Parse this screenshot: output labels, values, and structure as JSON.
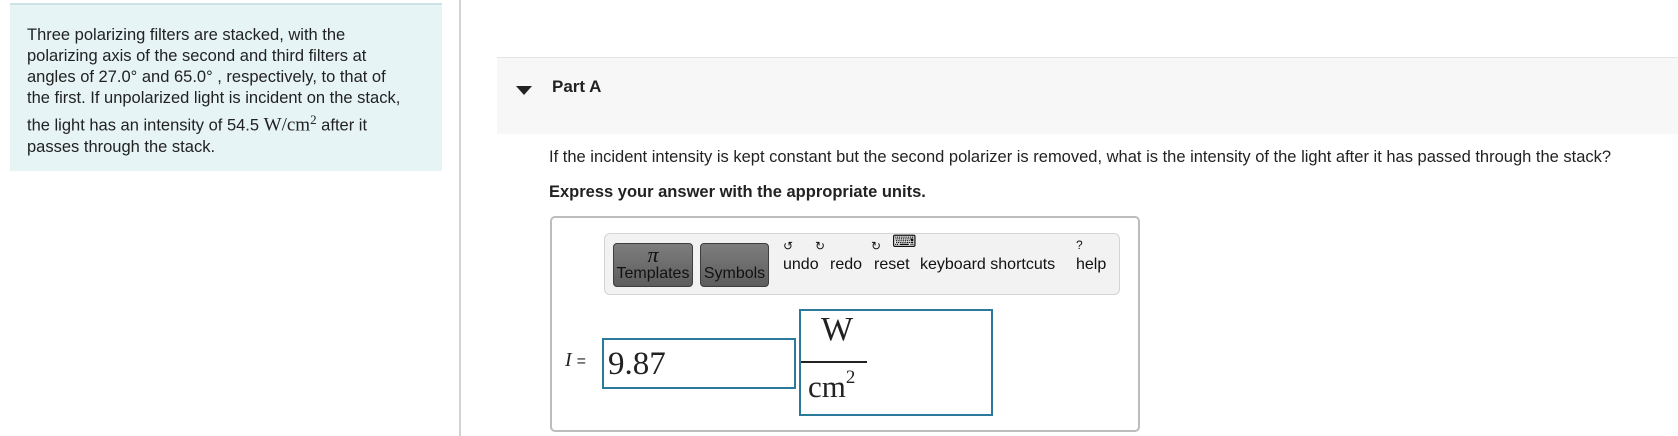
{
  "problem": {
    "line1": "Three polarizing filters are stacked, with the",
    "line2": "polarizing axis of the second and third filters at",
    "line3": "angles of 27.0° and 65.0° , respectively, to that of",
    "line4": "the first. If unpolarized light is incident on the stack,",
    "line5_pre": "the light has an intensity of 54.5 ",
    "line5_unit": "W/cm",
    "line5_exp": "2",
    "line5_post": " after it",
    "line6": "passes through the stack."
  },
  "part": {
    "title": "Part A"
  },
  "question": "If the incident intensity is kept constant but the second polarizer is removed, what is the intensity of the light after it has passed through the stack?",
  "instruction": "Express your answer with the appropriate units.",
  "toolbar": {
    "templates_label": "Templates",
    "templates_symbol": "π",
    "symbols_label": "Symbols",
    "undo_label": "undo",
    "redo_label": "redo",
    "reset_label": "reset",
    "shortcuts_label": "keyboard shortcuts",
    "help_label": "help",
    "keyboard_icon": "⌨"
  },
  "answer": {
    "variable": "I",
    "equals": "=",
    "value": "9.87",
    "unit_numerator": "W",
    "unit_denominator": "cm",
    "unit_exponent": "2"
  },
  "colors": {
    "problem_bg": "#e6f4f6",
    "input_border": "#2b7a9c",
    "part_header_bg": "#f7f7f7"
  }
}
